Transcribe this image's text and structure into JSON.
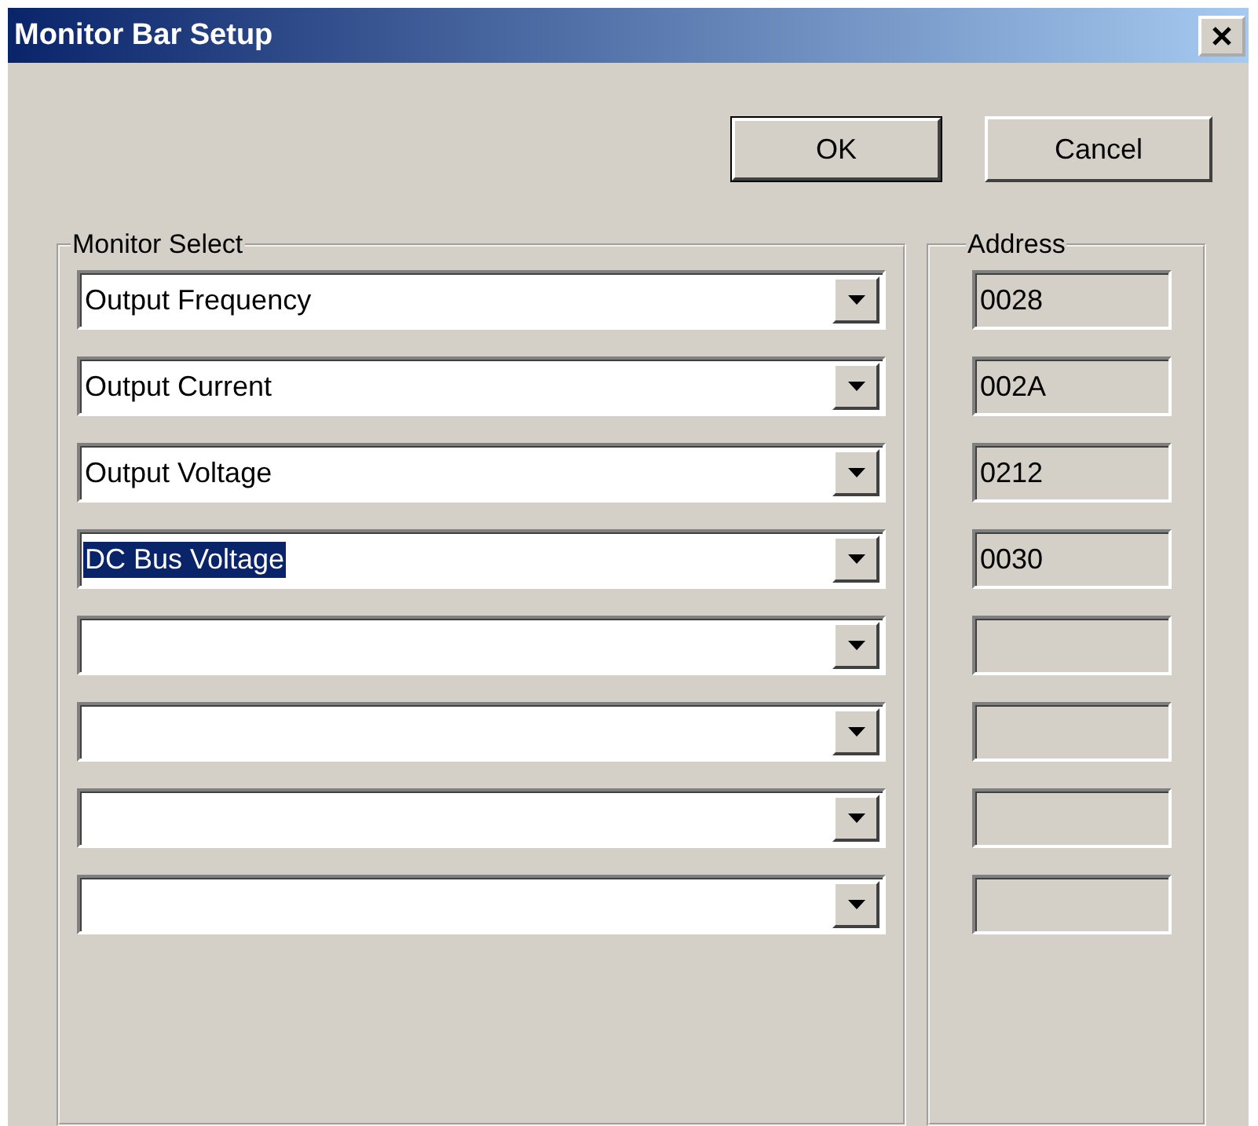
{
  "window": {
    "title": "Monitor Bar Setup"
  },
  "buttons": [
    {
      "label": "OK",
      "default": true
    },
    {
      "label": "Cancel",
      "default": false
    }
  ],
  "monitor_select": {
    "label": "Monitor Select"
  },
  "address": {
    "label": "Address"
  },
  "rows": [
    {
      "monitor": "Output Frequency",
      "selected": false,
      "address": "0028"
    },
    {
      "monitor": "Output Current",
      "selected": false,
      "address": "002A"
    },
    {
      "monitor": "Output Voltage",
      "selected": false,
      "address": "0212"
    },
    {
      "monitor": "DC Bus Voltage",
      "selected": true,
      "address": "0030"
    },
    {
      "selected": false
    },
    {
      "selected": false
    },
    {
      "selected": false
    },
    {
      "selected": false
    }
  ]
}
